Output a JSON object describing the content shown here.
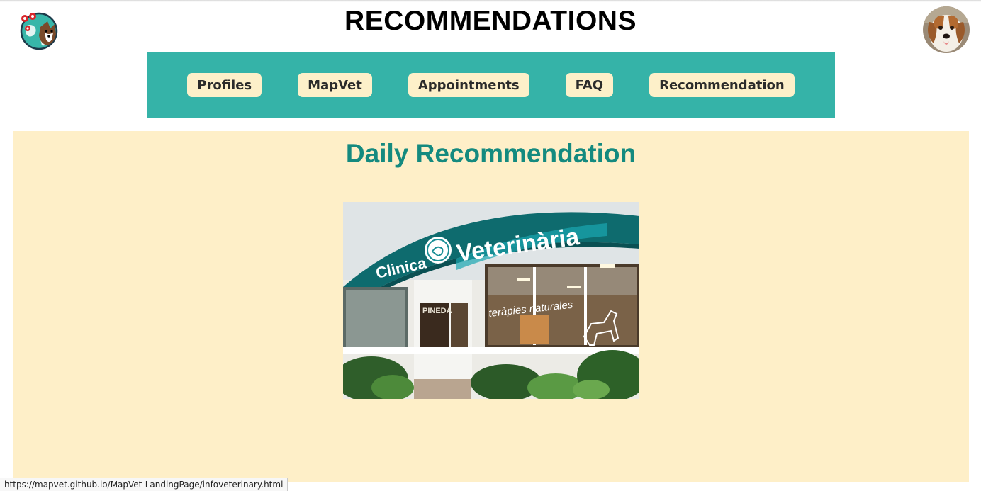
{
  "header": {
    "title": "RECOMMENDATIONS"
  },
  "nav": {
    "items": [
      {
        "label": "Profiles"
      },
      {
        "label": "MapVet"
      },
      {
        "label": "Appointments"
      },
      {
        "label": "FAQ"
      },
      {
        "label": "Recommendation"
      }
    ]
  },
  "main": {
    "section_title": "Daily Recommendation",
    "image": {
      "sign_clinica": "Clinica",
      "sign_veterinaria": "Veterinària",
      "window_text": "teràpies naturales",
      "door_text": "PINEDA"
    }
  },
  "status_bar": {
    "url": "https://mapvet.github.io/MapVet-LandingPage/infoveterinary.html"
  },
  "colors": {
    "nav_background": "#35b3a8",
    "nav_button": "#fdf0c9",
    "content_background": "#feefc8",
    "section_title": "#148a7f"
  },
  "icons": {
    "logo": "globe-dog-logo-icon",
    "avatar": "dog-avatar"
  }
}
